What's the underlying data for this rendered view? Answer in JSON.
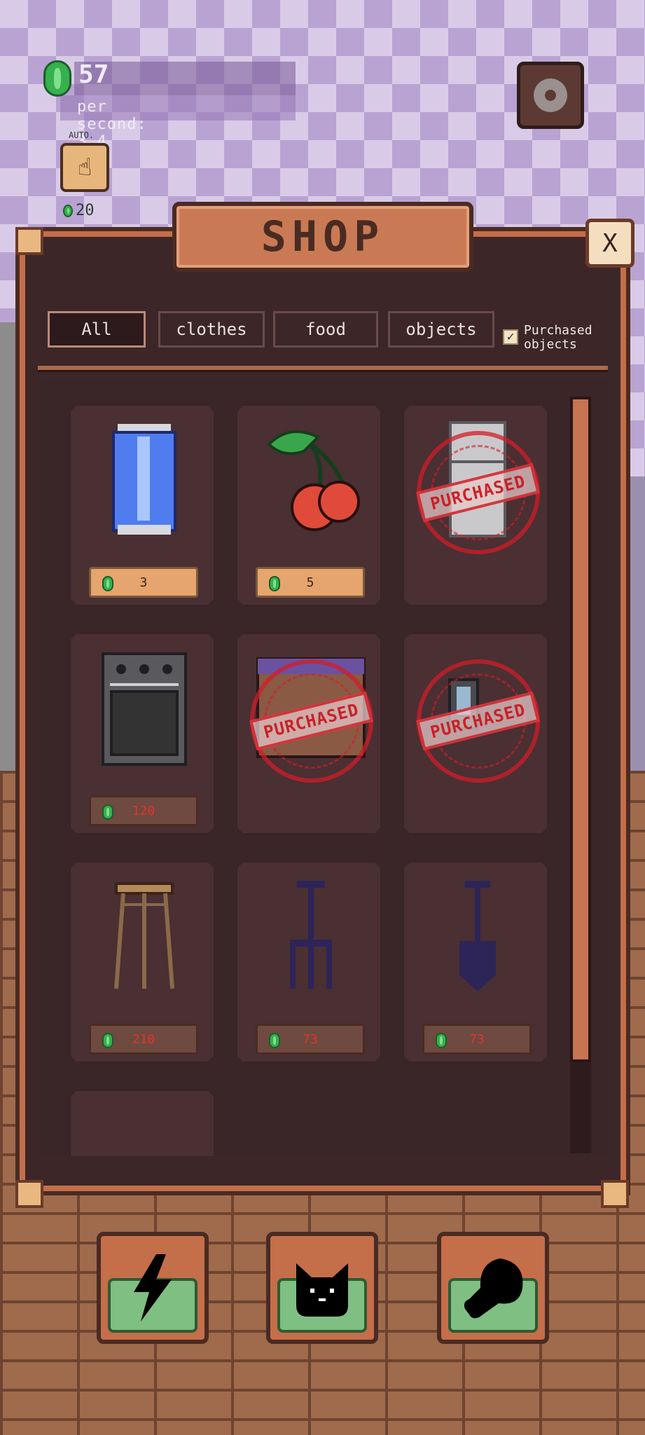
{
  "hud": {
    "coins": "57",
    "per_second": "per second: 3,4",
    "settings_icon": "gear-icon"
  },
  "auto": {
    "label": "AUTO.",
    "price": "20",
    "icon": "tap-hand-icon"
  },
  "shop": {
    "title": "SHOP",
    "close_label": "X",
    "tabs": [
      {
        "label": "All",
        "active": true
      },
      {
        "label": "clothes",
        "active": false
      },
      {
        "label": "food",
        "active": false
      },
      {
        "label": "objects",
        "active": false
      }
    ],
    "purchased_filter": {
      "label": "Purchased objects",
      "checked": true,
      "mark": "✓"
    },
    "purchased_stamp": "PURCHASED",
    "items": [
      {
        "icon": "soda-can-icon",
        "price": "3",
        "affordable": true,
        "purchased": false
      },
      {
        "icon": "cherries-icon",
        "price": "5",
        "affordable": true,
        "purchased": false
      },
      {
        "icon": "fridge-icon",
        "price": "",
        "affordable": false,
        "purchased": true
      },
      {
        "icon": "oven-icon",
        "price": "120",
        "affordable": false,
        "purchased": false
      },
      {
        "icon": "cabinet-icon",
        "price": "",
        "affordable": false,
        "purchased": true
      },
      {
        "icon": "appliance-icon",
        "price": "",
        "affordable": false,
        "purchased": true
      },
      {
        "icon": "stool-icon",
        "price": "210",
        "affordable": false,
        "purchased": false
      },
      {
        "icon": "pitchfork-icon",
        "price": "73",
        "affordable": false,
        "purchased": false
      },
      {
        "icon": "shovel-icon",
        "price": "73",
        "affordable": false,
        "purchased": false
      },
      {
        "icon": "hat-icon",
        "price": "",
        "affordable": false,
        "purchased": false
      }
    ]
  },
  "bottom_nav": [
    {
      "icon": "lightning-icon"
    },
    {
      "icon": "cat-icon"
    },
    {
      "icon": "drumstick-icon"
    }
  ],
  "colors": {
    "panel": "#3c2628",
    "panel_border": "#c46e4a",
    "price_affordable": "#e6a56e",
    "price_unaffordable": "#6e4a40",
    "price_unaffordable_text": "#e0352c",
    "stamp_red": "#d21e28",
    "coin_green": "#37b04e"
  }
}
